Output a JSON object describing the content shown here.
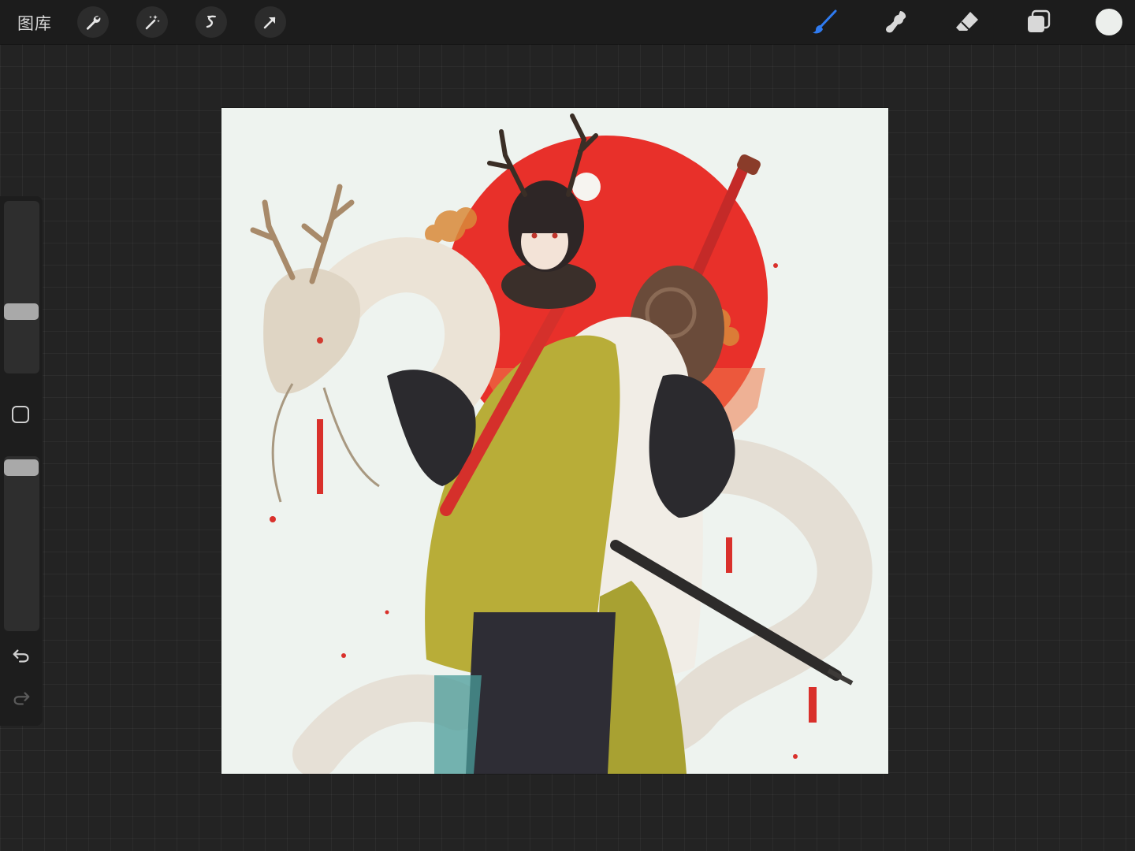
{
  "toolbar": {
    "gallery_label": "图库",
    "left_tools": [
      "wrench-icon",
      "magic-wand-icon",
      "selection-icon",
      "transform-arrow-icon"
    ],
    "right_tools": [
      "brush-icon",
      "smudge-icon",
      "eraser-icon",
      "layers-icon"
    ],
    "active_tool": "brush",
    "accent_color": "#2f7bf0",
    "current_color": "#ecefec"
  },
  "sidebar": {
    "brush_size_level": 0.63,
    "opacity_level": 0.97,
    "icons": [
      "modify-square-icon",
      "undo-icon",
      "redo-icon"
    ]
  },
  "canvas": {
    "artwork": "illustration",
    "colors": {
      "paper": "#eef3ef",
      "sun": "#e8302a",
      "robe_green": "#b8ad38",
      "dark": "#2b2a2e",
      "dragon": "#ebe3d6"
    }
  }
}
